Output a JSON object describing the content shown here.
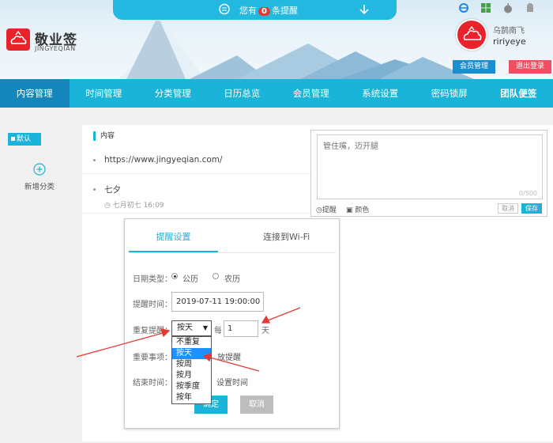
{
  "notify": {
    "prefix": "您有",
    "count": "0",
    "suffix": "条提醒"
  },
  "brand": {
    "name": "敬业签",
    "sub": "JINGYEQIAN"
  },
  "user": {
    "name": "乌鹊南飞",
    "id": "ririyeye"
  },
  "header_buttons": {
    "member": "会员管理",
    "logout": "退出登录"
  },
  "nav": [
    {
      "label": "内容管理",
      "active": true
    },
    {
      "label": "时间管理"
    },
    {
      "label": "分类管理"
    },
    {
      "label": "日历总览"
    },
    {
      "label": "会员管理"
    },
    {
      "label": "系统设置"
    },
    {
      "label": "密码锁屏"
    },
    {
      "label": "团队便签"
    }
  ],
  "sidebar": {
    "default_label": "默认",
    "add_label": "新增分类"
  },
  "content": {
    "header": "内容",
    "items": [
      {
        "text": "https://www.jingyeqian.com/"
      },
      {
        "text": "七夕",
        "time": "七月初七 16:09"
      }
    ]
  },
  "editor": {
    "placeholder": "管住嘴，迈开腿",
    "count": "0/500",
    "remind_label": "提醒",
    "color_label": "颜色",
    "cancel": "取消",
    "save": "保存"
  },
  "dialog": {
    "tab_reminder": "提醒设置",
    "tab_wifi": "连接到Wi-Fi",
    "date_type_label": "日期类型：",
    "solar": "公历",
    "lunar": "农历",
    "remind_time_label": "提醒时间：",
    "remind_time_value": "2019-07-11 19:00:00",
    "repeat_label": "重复提醒：",
    "repeat_selected": "按天",
    "every": "每",
    "every_value": "1",
    "day_unit": "天",
    "important_label": "重要事项：",
    "important_hint": "放提醒",
    "end_label": "结束时间：",
    "end_hint": "设置时间",
    "repeat_options": [
      "不重复",
      "按天",
      "按周",
      "按月",
      "按季度",
      "按年"
    ],
    "ok": "确定",
    "cancel": "取消"
  },
  "colors": {
    "accent": "#1ab4d8",
    "nav_active": "#1486bb",
    "logo": "#e8232b",
    "logout": "#f04e62",
    "annotation": "#e53935"
  }
}
